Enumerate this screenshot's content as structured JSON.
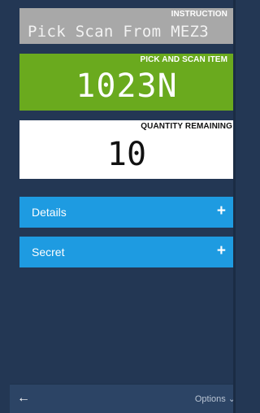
{
  "instruction": {
    "caption": "INSTRUCTION",
    "text": "Pick Scan From MEZ3"
  },
  "pick_item": {
    "caption": "PICK AND SCAN ITEM",
    "value": "1023N"
  },
  "quantity": {
    "caption": "QUANTITY REMAINING",
    "value": "10"
  },
  "sections": [
    {
      "label": "Details",
      "expand_glyph": "+"
    },
    {
      "label": "Secret",
      "expand_glyph": "+"
    }
  ],
  "footer": {
    "back_glyph": "←",
    "back_icon": "back-arrow-icon",
    "options_label": "Options",
    "options_glyph": "⌄"
  },
  "colors": {
    "background": "#233754",
    "instruction_panel": "#a8a8a8",
    "pick_panel": "#6aaa1e",
    "quantity_panel": "#ffffff",
    "accordion": "#1e9be1",
    "footer": "#2c4465"
  }
}
